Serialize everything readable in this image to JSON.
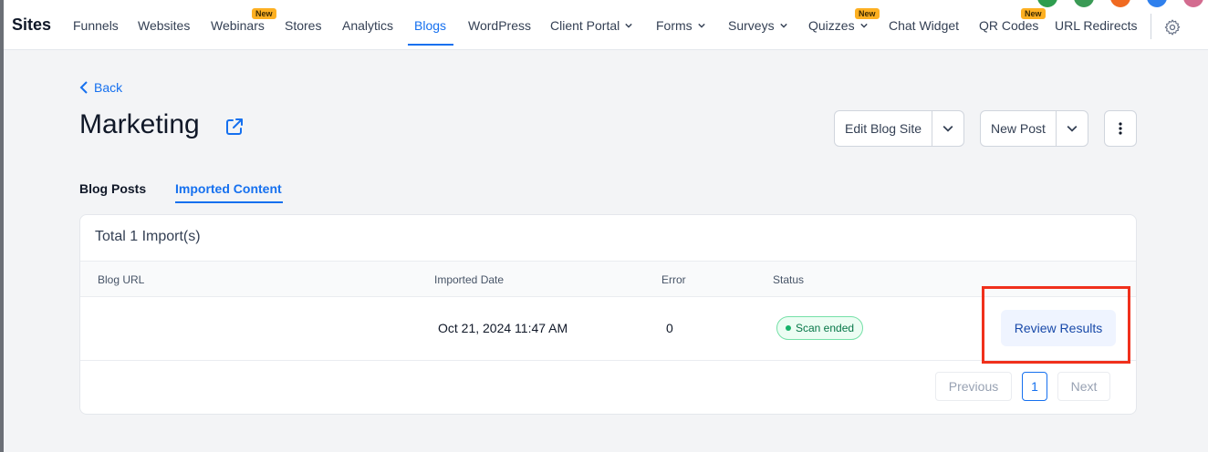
{
  "topnav": {
    "brand": "Sites",
    "items": [
      {
        "label": "Funnels"
      },
      {
        "label": "Websites"
      },
      {
        "label": "Webinars",
        "badge": "New"
      },
      {
        "label": "Stores"
      },
      {
        "label": "Analytics"
      },
      {
        "label": "Blogs",
        "active": true
      },
      {
        "label": "WordPress"
      },
      {
        "label": "Client Portal"
      },
      {
        "label": "Forms"
      },
      {
        "label": "Surveys"
      },
      {
        "label": "Quizzes",
        "badge": "New"
      },
      {
        "label": "Chat Widget"
      },
      {
        "label": "QR Codes",
        "badge": "New"
      },
      {
        "label": "URL Redirects"
      }
    ],
    "settings_icon": "gear-icon",
    "accent_color": "#1570ef"
  },
  "header": {
    "back_label": "Back",
    "title": "Marketing",
    "edit_button": "Edit Blog Site",
    "new_post_button": "New Post"
  },
  "tabs": [
    {
      "label": "Blog Posts"
    },
    {
      "label": "Imported Content",
      "active": true
    }
  ],
  "imports": {
    "total_label": "Total 1 Import(s)",
    "columns": [
      "Blog URL",
      "Imported Date",
      "Error",
      "Status"
    ],
    "rows": [
      {
        "blog_url": "",
        "imported_date": "Oct 21, 2024 11:47 AM",
        "error": "0",
        "status": "Scan ended",
        "action": "Review Results"
      }
    ],
    "pagination": {
      "previous": "Previous",
      "current_page": "1",
      "next": "Next"
    }
  },
  "colors": {
    "status_success": "#067647",
    "highlight_box": "#f0301c"
  }
}
